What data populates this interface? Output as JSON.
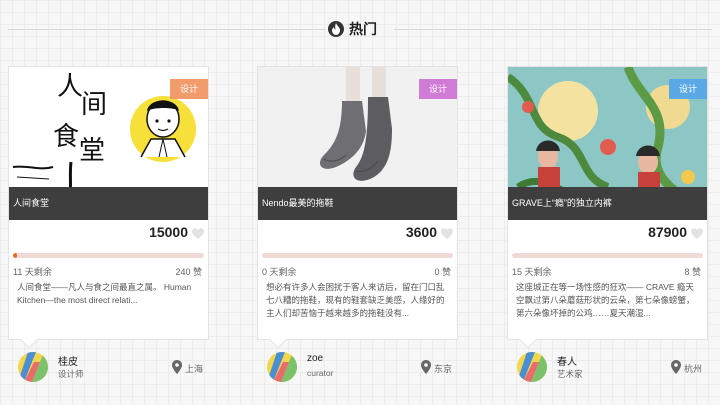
{
  "section": {
    "title": "热门",
    "icon": "fire-icon"
  },
  "cards": [
    {
      "caption": "人间食堂",
      "tag": "设计",
      "tag_color": "#f39c6b",
      "amount": "15000",
      "progress": 0.02,
      "days": "11 天剩余",
      "likes": "240 赞",
      "desc": "人间食堂——凡人与食之间最直之属。 Human Kitchen—the most direct relati...",
      "artwork_text": "人间食堂",
      "user": {
        "name": "桂皮",
        "role": "设计师",
        "city": "上海"
      }
    },
    {
      "caption": "Nendo最美的拖鞋",
      "tag": "设计",
      "tag_color": "#d07bd6",
      "amount": "3600",
      "progress": 0,
      "days": "0 天剩余",
      "likes": "0 赞",
      "desc": "想必有许多人会困扰于客人来访后，留在门口乱七八糟的拖鞋，现有的鞋套缺乏美感，人缘好的主人们却苦恼于越来越多的拖鞋没有...",
      "user": {
        "name": "zoe",
        "role": "curator",
        "city": "东京"
      }
    },
    {
      "caption": "GRAVE上“瘾”的独立内裤",
      "tag": "设计",
      "tag_color": "#5aa9e6",
      "amount": "87900",
      "progress": 0,
      "days": "15 天剩余",
      "likes": "8 赞",
      "desc": "这座城正在等一场性感的狂欢—— CRAVE 瘾天空飘过第八朵蘑菇形状的云朵，第七朵像螃蟹，第六朵像坏掉的公鸡……夏天潮湿...",
      "user": {
        "name": "春人",
        "role": "艺术家",
        "city": "杭州"
      }
    }
  ]
}
